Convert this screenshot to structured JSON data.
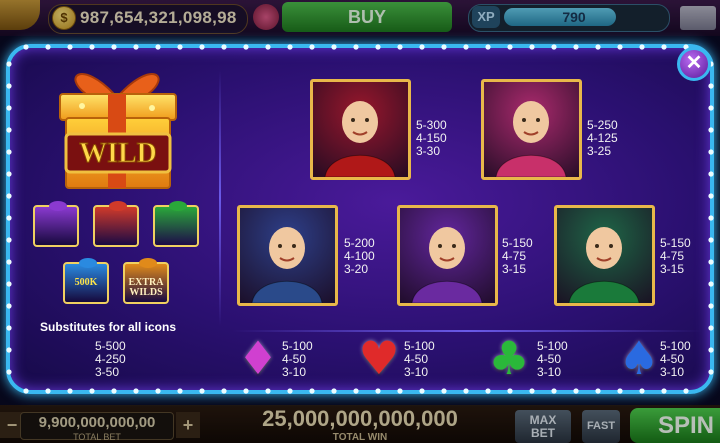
{
  "topbar": {
    "balance": "987,654,321,098,98",
    "coin_glyph": "$",
    "buy_label": "BUY",
    "xp_label": "XP",
    "xp_value": "790",
    "xp_progress": 0.7
  },
  "bottombar": {
    "total_bet": "9,900,000,000,00",
    "total_bet_label": "TOTAL BET",
    "total_win": "25,000,000,000,000",
    "total_win_label": "TOTAL WIN",
    "max_bet_label": "MAX BET",
    "fast_label": "FAST",
    "spin_label": "SPIN"
  },
  "paytable": {
    "close_glyph": "✕",
    "wild": {
      "label": "WILD",
      "subtitle": "Substitutes for all icons",
      "payouts": [
        "5-500",
        "4-250",
        "3-50"
      ],
      "bonus_gifts": [
        {
          "label": "",
          "color": "#8a3ad0"
        },
        {
          "label": "",
          "color": "#d03a2a"
        },
        {
          "label": "",
          "color": "#2aa83a"
        },
        {
          "label": "500K",
          "color": "#2a8ae0"
        },
        {
          "label": "EXTRA WILDS",
          "color": "#e08a1a"
        }
      ]
    },
    "characters": [
      {
        "name": "santa",
        "payouts": [
          "5-300",
          "4-150",
          "3-30"
        ],
        "bg": "#b01818"
      },
      {
        "name": "lady-gift",
        "payouts": [
          "5-250",
          "4-125",
          "3-25"
        ],
        "bg": "#c8306a"
      },
      {
        "name": "man-suit",
        "payouts": [
          "5-200",
          "4-100",
          "3-20"
        ],
        "bg": "#2a4a8a"
      },
      {
        "name": "cowboy",
        "payouts": [
          "5-150",
          "4-75",
          "3-15"
        ],
        "bg": "#6a2aa0"
      },
      {
        "name": "dealer",
        "payouts": [
          "5-150",
          "4-75",
          "3-15"
        ],
        "bg": "#1a7a3a"
      }
    ],
    "suits": [
      {
        "name": "diamond",
        "glyph": "♦",
        "color": "#d040d0",
        "payouts": [
          "5-100",
          "4-50",
          "3-10"
        ]
      },
      {
        "name": "heart",
        "glyph": "♥",
        "color": "#e02a2a",
        "payouts": [
          "5-100",
          "4-50",
          "3-10"
        ]
      },
      {
        "name": "club",
        "glyph": "♣",
        "color": "#2ab83a",
        "payouts": [
          "5-100",
          "4-50",
          "3-10"
        ]
      },
      {
        "name": "spade",
        "glyph": "♠",
        "color": "#2a6ae0",
        "payouts": [
          "5-100",
          "4-50",
          "3-10"
        ]
      }
    ]
  }
}
